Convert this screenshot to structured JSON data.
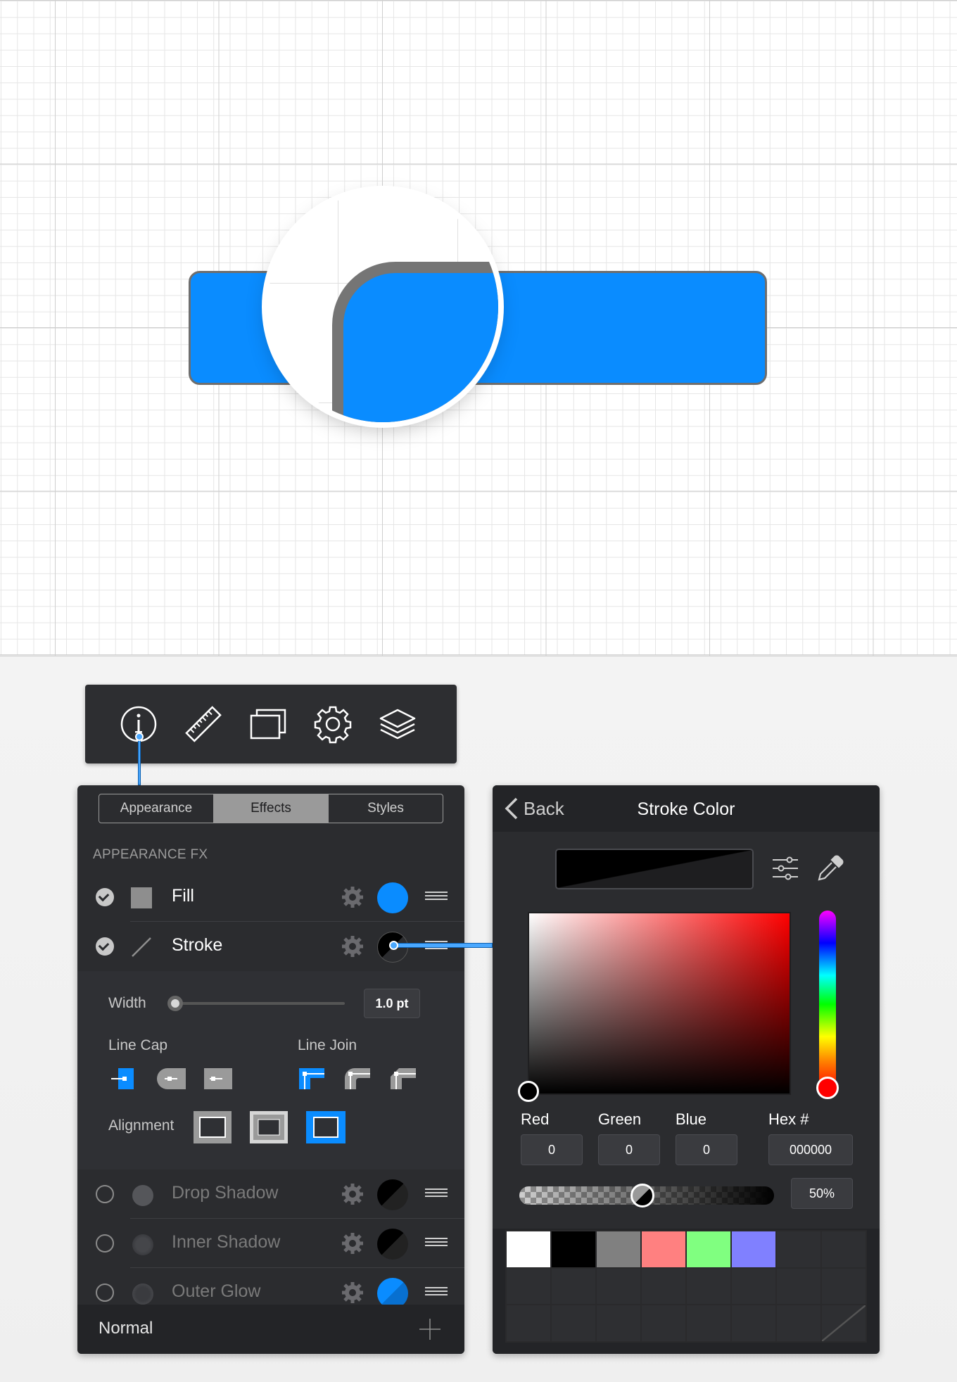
{
  "toolbar": {
    "icons": [
      "info-icon",
      "ruler-icon",
      "artboards-icon",
      "settings-icon",
      "layers-icon"
    ]
  },
  "left_panel": {
    "tabs": [
      {
        "label": "Appearance",
        "active": false
      },
      {
        "label": "Effects",
        "active": true
      },
      {
        "label": "Styles",
        "active": false
      }
    ],
    "section_header": "APPEARANCE FX",
    "fx": {
      "fill": {
        "label": "Fill",
        "enabled": true,
        "color": "#0a8cff"
      },
      "stroke": {
        "label": "Stroke",
        "enabled": true,
        "color": "#000000"
      },
      "drop_shadow": {
        "label": "Drop Shadow",
        "enabled": false,
        "color": "#000000"
      },
      "inner_shadow": {
        "label": "Inner Shadow",
        "enabled": false,
        "color": "#000000"
      },
      "outer_glow": {
        "label": "Outer Glow",
        "enabled": false,
        "color": "#0a8cff"
      }
    },
    "stroke_settings": {
      "width_label": "Width",
      "width_value": "1.0 pt",
      "line_cap_label": "Line Cap",
      "line_join_label": "Line Join",
      "alignment_label": "Alignment",
      "selected_cap": "butt",
      "selected_join": "miter",
      "selected_alignment": "outside"
    },
    "blend_mode": "Normal"
  },
  "right_panel": {
    "back_label": "Back",
    "title": "Stroke Color",
    "red_label": "Red",
    "green_label": "Green",
    "blue_label": "Blue",
    "hex_label": "Hex #",
    "red_value": "0",
    "green_value": "0",
    "blue_value": "0",
    "hex_value": "000000",
    "opacity_value": "50%",
    "swatches": [
      "#ffffff",
      "#000000",
      "#808080",
      "#ff8080",
      "#80ff80",
      "#8080ff"
    ]
  },
  "colors": {
    "accent": "#0a8cff",
    "panel_bg": "#2b2c2f"
  }
}
